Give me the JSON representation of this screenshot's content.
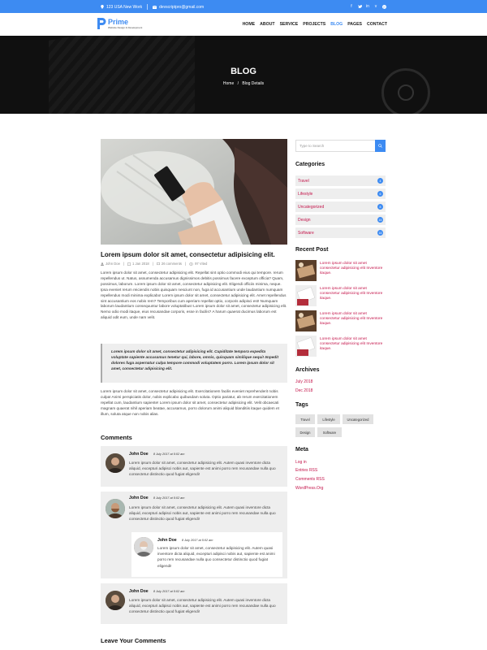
{
  "topbar": {
    "address": "123 USA New Work",
    "email": "devscriptpro@gmail.com",
    "social": [
      "facebook-icon",
      "twitter-icon",
      "linkedin-icon",
      "vimeo-icon",
      "pinterest-icon"
    ]
  },
  "brand": {
    "name": "Prime",
    "tagline": "Website Design & Development"
  },
  "nav": [
    "HOME",
    "ABOUT",
    "SERVICE",
    "PROJECTS",
    "BLOG",
    "PAGES",
    "CONTACT"
  ],
  "banner": {
    "title": "BLOG",
    "crumb_home": "Home",
    "crumb_sep": "/",
    "crumb_current": "Blog Details"
  },
  "post": {
    "title": "Lorem ipsum dolor sit amet, consectetur adipisicing elit.",
    "author": "John Doe",
    "date": "1 Jan 2018",
    "comments": "26 comments",
    "views": "97 Vited",
    "body1": "Lorem ipsum dolor sit amet, consectetur adipisicing elit. Repellat sint optio commodi eius qui tempore. rerum repellendus ut. Natus, assumenda accusamus dignissimos debitis possimus facere exceptum officia? Quam, possimus, laborum. Lorem ipsum dolor sit amet, consectetur adipisicing elit. Eligendi officiis minima, neque. Ipsa eveniet rerum reiciendis nobis quisquam nesciunt non, fuga id accusantium unde laudantium numquam repellendus modi minima explicabo! Lorem ipsum dolor sit amet, consectetur adipisicing elit. Amet repellendus sint accusantium eos nobis rem? Temporibus cum aperiam repellat optio, corporis adipisci est! Numquam laborum laudantium consequuntur labore voluptatibus! Lorem ipsum dolor sit amet, consectetur adipisicing elit. Nemo odio modi itaque, eius recusandae corporis, esse in facilis? A harum quaerat ducimus laborum est aliquid odit eum, unde nam velit.",
    "quote": "Lorem ipsum dolor sit amet, consectetur adipisicing elit. Cupiditate tempora expedita voluptate sapiente accusamus tenetur qui, labore, omnis, quisquam similique sequi! Impedit dolores fuga aspernatur culpa tempore commodi voluptatem porro. Lorem ipsum dolor sit amet, consectetur adipisicing elit.",
    "body2": "Lorem ipsum dolor sit amet, consectetur adipisicing elit. Exercitationem facilis eveniet reprehenderit nobis culpa! Animi perspiciatis dolor, nobis explicabo quibusdam soluta. Optio pariatur, ab rerum exercitationem repellat cum, laudantium sapiente! Lorem ipsum dolor sit amet, consectetur adipisicing elit. Velit obcaecati magnam quaerat nihil aperiam beatae, accusamus, porro dolorum animi aliquid blanditiis itaque quidem et illum, soluta atque non nobis alias."
  },
  "comments_heading": "Comments",
  "comments": [
    {
      "name": "John Doe",
      "date": "8 July 2017 at 5:02 am",
      "text": "Lorem ipsum dolor sit amet, consectetur adipisicing elit. Autem quasi inventore dicta aliquid, excepturi adipisci nobis aut, sapiente est animi porro rem recusandae nulla quo consectetur distinctio quod fugiat eligendi!"
    },
    {
      "name": "John Doe",
      "date": "8 July 2017 at 5:02 am",
      "text": "Lorem ipsum dolor sit amet, consectetur adipisicing elit. Autem quasi inventore dicta aliquid, excepturi adipisci nobis aut, sapiente est animi porro rem recusandae nulla quo consectetur distinctio quod fugiat eligendi!"
    },
    {
      "name": "John Doe",
      "date": "8 July 2017 at 5:02 am",
      "text": "Lorem ipsum dolor sit amet, consectetur adipisicing elit. Autem quasi inventore dicta aliquid, excepturi adipisci nobis aut, sapiente est animi porro rem recusandae nulla quo consectetur distinctio quod fugiat eligendi!"
    },
    {
      "name": "John Doe",
      "date": "8 July 2017 at 5:02 am",
      "text": "Lorem ipsum dolor sit amet, consectetur adipisicing elit. Autem quasi inventore dicta aliquid, excepturi adipisci nobis aut, sapiente est animi porro rem recusandae nulla quo consectetur distinctio quod fugiat eligendi!"
    }
  ],
  "leave_heading": "Leave Your Comments",
  "sidebar": {
    "search_placeholder": "Type to Search",
    "categories_title": "Categories",
    "categories": [
      {
        "label": "Travel",
        "count": "4"
      },
      {
        "label": "Lifestyle",
        "count": "6"
      },
      {
        "label": "Uncategorized",
        "count": "8"
      },
      {
        "label": "Design",
        "count": "16"
      },
      {
        "label": "Software",
        "count": "16"
      }
    ],
    "recent_title": "Recent Post",
    "recent": [
      "Lorem ipsum dolor sit amet consectetur adipisicing elit Inventore itaque.",
      "Lorem ipsum dolor sit amet consectetur adipisicing elit Inventore itaque.",
      "Lorem ipsum dolor sit amet consectetur adipisicing elit Inventore itaque.",
      "Lorem ipsum dolor sit amet consectetur adipisicing elit Inventore itaque."
    ],
    "archives_title": "Archives",
    "archives": [
      "July 2018",
      "Dec 2018"
    ],
    "tags_title": "Tags",
    "tags": [
      "Travel",
      "Lifestyle",
      "Uncategorized",
      "Design",
      "Software"
    ],
    "meta_title": "Meta",
    "meta": [
      "Log in",
      "Entries RSS",
      "Comments RSS",
      "WordPress.Org"
    ]
  },
  "colors": {
    "accent": "#3d8bf2",
    "link": "#c4144a",
    "panel": "#eeeeee"
  }
}
